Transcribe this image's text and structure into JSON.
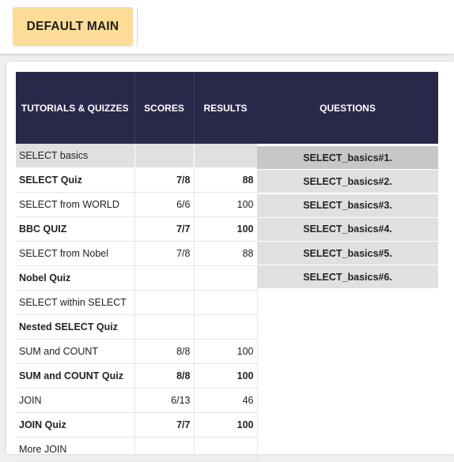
{
  "header": {
    "main_button": "DEFAULT MAIN"
  },
  "table": {
    "columns": [
      "TUTORIALS & QUIZZES",
      "SCORES",
      "RESULTS"
    ],
    "rows": [
      {
        "name": "SELECT basics",
        "score": "",
        "result": "",
        "bold": false
      },
      {
        "name": "SELECT Quiz",
        "score": "7/8",
        "result": "88",
        "bold": true
      },
      {
        "name": "SELECT from WORLD",
        "score": "6/6",
        "result": "100",
        "bold": false
      },
      {
        "name": "BBC QUIZ",
        "score": "7/7",
        "result": "100",
        "bold": true
      },
      {
        "name": "SELECT from Nobel",
        "score": "7/8",
        "result": "88",
        "bold": false
      },
      {
        "name": "Nobel Quiz",
        "score": "",
        "result": "",
        "bold": true
      },
      {
        "name": "SELECT within SELECT",
        "score": "",
        "result": "",
        "bold": false
      },
      {
        "name": "Nested SELECT Quiz",
        "score": "",
        "result": "",
        "bold": true
      },
      {
        "name": "SUM and COUNT",
        "score": "8/8",
        "result": "100",
        "bold": false
      },
      {
        "name": "SUM and COUNT Quiz",
        "score": "8/8",
        "result": "100",
        "bold": true
      },
      {
        "name": "JOIN",
        "score": "6/13",
        "result": "46",
        "bold": false
      },
      {
        "name": "JOIN Quiz",
        "score": "7/7",
        "result": "100",
        "bold": true
      },
      {
        "name": "More JOIN",
        "score": "",
        "result": "",
        "bold": false
      }
    ]
  },
  "questions": {
    "header": "QUESTIONS",
    "items": [
      "SELECT_basics#1.",
      "SELECT_basics#2.",
      "SELECT_basics#3.",
      "SELECT_basics#4.",
      "SELECT_basics#5.",
      "SELECT_basics#6."
    ]
  }
}
